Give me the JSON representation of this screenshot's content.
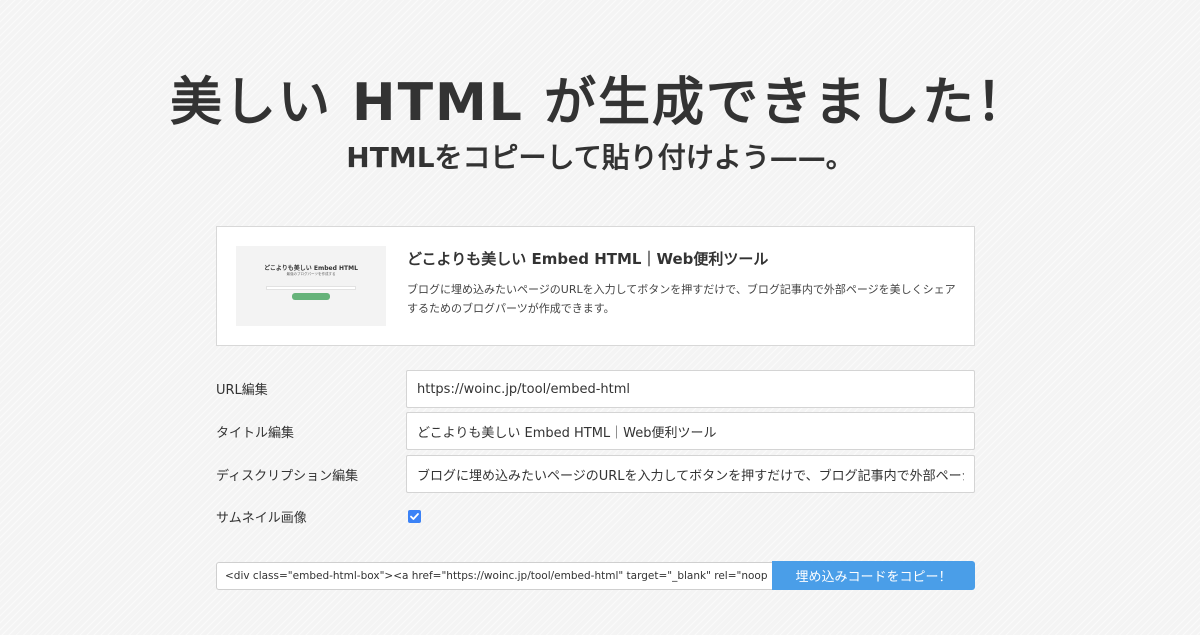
{
  "hero": {
    "title": "美しい HTML が生成できました！",
    "subtitle": "HTMLをコピーして貼り付けよう——。"
  },
  "preview": {
    "title": "どこよりも美しい Embed HTML｜Web便利ツール",
    "description": "ブログに埋め込みたいページのURLを入力してボタンを押すだけで、ブログ記事内で外部ページを美しくシェアするためのブログパーツが作成できます。",
    "thumbnail": {
      "title": "どこよりも美しい Embed HTML",
      "subtitle": "最強のブログパーツを作成する"
    }
  },
  "form": {
    "url_label": "URL編集",
    "url_value": "https://woinc.jp/tool/embed-html",
    "title_label": "タイトル編集",
    "title_value": "どこよりも美しい Embed HTML｜Web便利ツール",
    "description_label": "ディスクリプション編集",
    "description_value": "ブログに埋め込みたいページのURLを入力してボタンを押すだけで、ブログ記事内で外部ページを美しくシェアするためのブログパーツが作成できます。",
    "thumbnail_label": "サムネイル画像",
    "thumbnail_checked": true
  },
  "embed": {
    "code": "<div class=\"embed-html-box\"><a href=\"https://woinc.jp/tool/embed-html\" target=\"_blank\" rel=\"noopener\">",
    "copy_label": "埋め込みコードをコピー！",
    "accent_color": "#4a9ee8"
  }
}
